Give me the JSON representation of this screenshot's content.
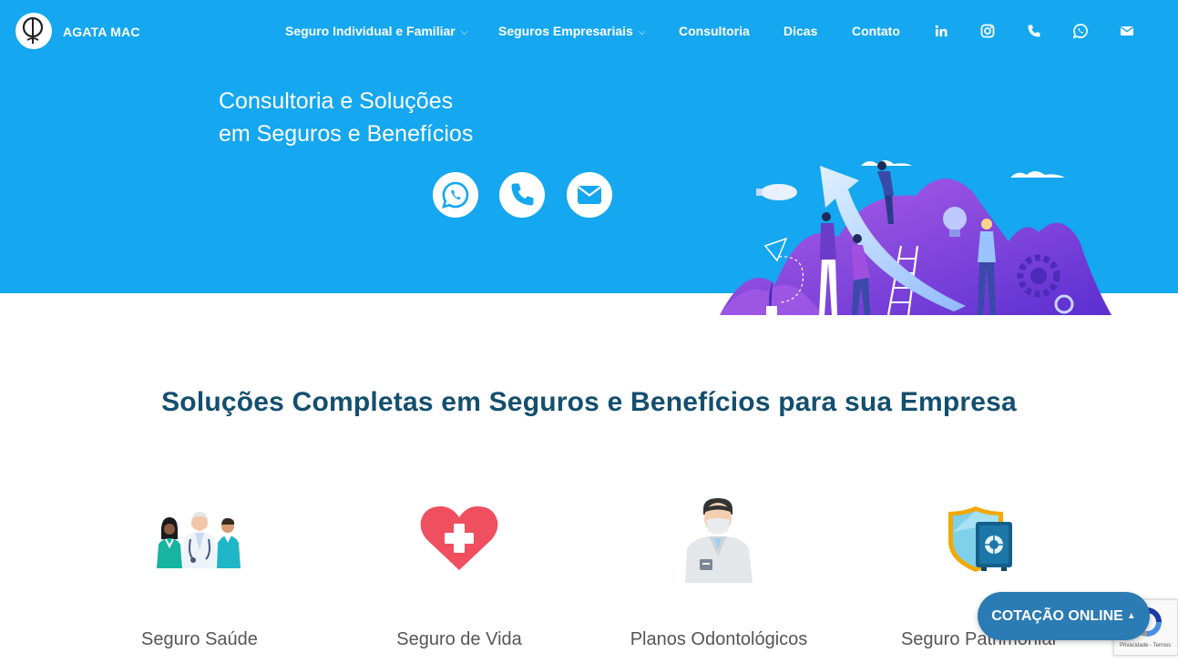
{
  "header": {
    "brand": "AGATA MAC",
    "nav": [
      {
        "label": "Seguro Individual e Familiar",
        "dropdown": true
      },
      {
        "label": "Seguros Empresariais",
        "dropdown": true
      },
      {
        "label": "Consultoria",
        "dropdown": false
      },
      {
        "label": "Dicas",
        "dropdown": false
      },
      {
        "label": "Contato",
        "dropdown": false
      }
    ],
    "chevron": "⌵",
    "social_icons": [
      "linkedin-icon",
      "instagram-icon",
      "phone-icon",
      "whatsapp-icon",
      "email-icon"
    ]
  },
  "hero": {
    "title_line1": "Consultoria e Soluções",
    "title_line2": "em Seguros e Benefícios",
    "buttons": [
      "whatsapp-icon",
      "phone-icon",
      "email-icon"
    ]
  },
  "section": {
    "title": "Soluções Completas em Seguros e Benefícios para sua Empresa"
  },
  "cards": [
    {
      "label": "Seguro Saúde",
      "icon": "doctors-icon"
    },
    {
      "label": "Seguro de Vida",
      "icon": "heart-plus-icon"
    },
    {
      "label": "Planos Odontológicos",
      "icon": "dentist-icon"
    },
    {
      "label": "Seguro Patrimonial",
      "icon": "shield-safe-icon"
    }
  ],
  "floating": {
    "cotacao": "COTAÇÃO ONLINE",
    "caret": "▲",
    "recaptcha": "Privacidade - Termos"
  },
  "colors": {
    "hero_bg": "#15a7ef",
    "heading": "#134f6f",
    "cta": "#2b7bb4"
  }
}
